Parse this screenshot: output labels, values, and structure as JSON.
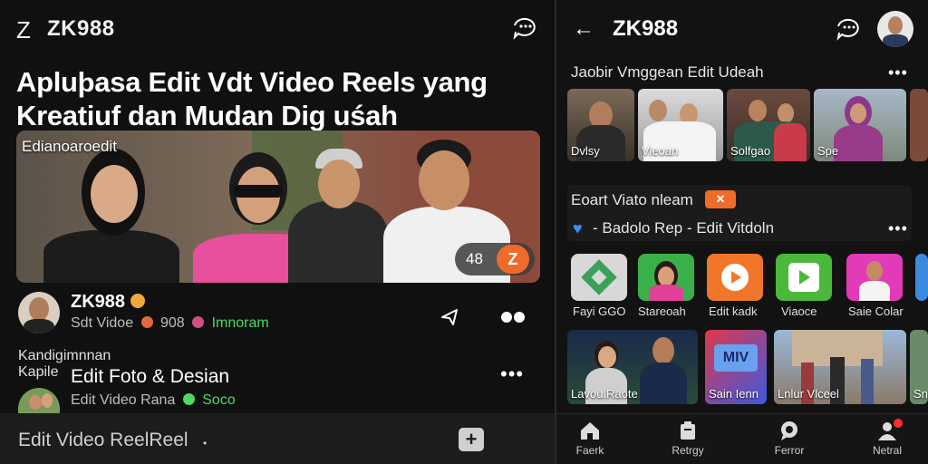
{
  "left": {
    "logo_mark": "Z",
    "app_name": "ZK988",
    "headline_line1": "Apluþasa Edit Vdt Video Reels yang",
    "headline_line2": "Kreatiuf dan Mudan Dig uśah",
    "hero": {
      "label": "Edianoaroedit",
      "pill_text": "48",
      "pill_button": "Z"
    },
    "post1": {
      "title": "ZK988",
      "sub_prefix": "Sdt Vidoe",
      "sub_number": "908",
      "sub_tag": "Imnoram"
    },
    "side_label_1": "Kandigimnnan",
    "side_label_2": "Kapile",
    "post2": {
      "title": "Edit Foto & Desian",
      "sub_prefix": "Edit Video Rana",
      "sub_tag": "Soco"
    },
    "composer": {
      "text": "Edit Video ReelReel",
      "add_button": "+"
    }
  },
  "right": {
    "title": "ZK988",
    "section1": "Jaobir Vmggean Edit Udeah",
    "tiles_row1": [
      "Dvlsy",
      "Vieoan",
      "Solfgao",
      "Spe",
      ""
    ],
    "section2": "Eoart Viato nleam",
    "section2_badge": "✕",
    "section2_item": "- Badolo Rep - Edit Vitdoln",
    "apps": [
      "Fayi GGO",
      "Stareoah",
      "Edit kadk",
      "Viaoce",
      "Saie Colar",
      ""
    ],
    "tiles_row3": [
      "Lavou.Raote",
      "Sain Ienn",
      "Lnlur Vlceel",
      "Sn"
    ],
    "nav": [
      "Faerk",
      "Retrgy",
      "Ferror",
      "Netral"
    ]
  },
  "colors": {
    "accent": "#f06a2a",
    "background": "#0b0b0b",
    "green": "#4cd964",
    "blue_heart": "#3b8cff"
  }
}
